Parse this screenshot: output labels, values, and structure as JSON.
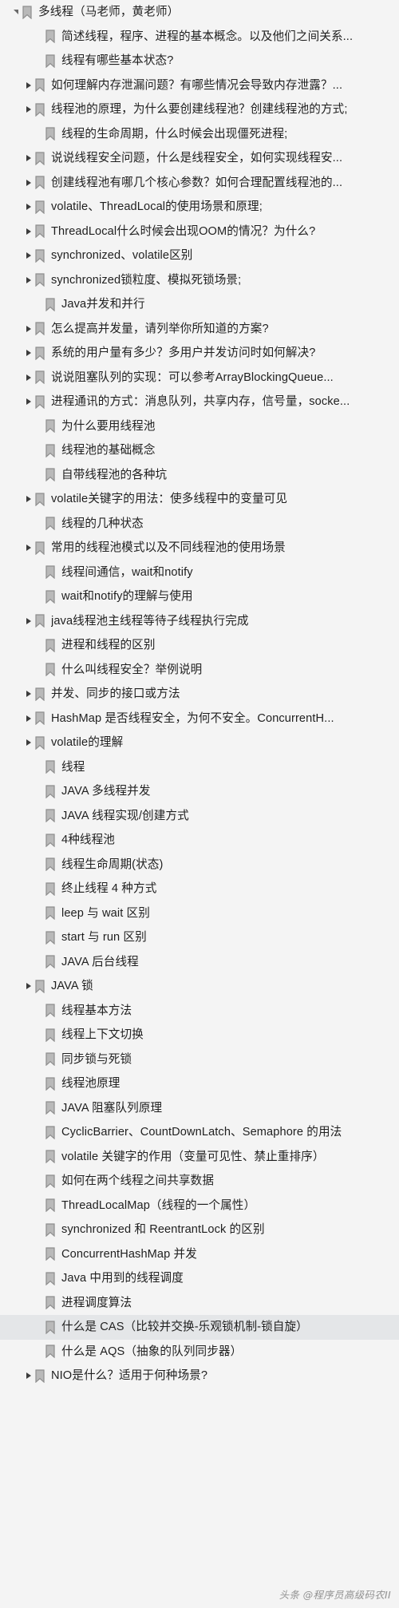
{
  "panel": {
    "background_color": "#f4f4f4",
    "selected_row_color": "#e4e6e8",
    "icon_name": "bookmark-icon",
    "expand_icon_name": "triangle-right-icon",
    "collapse_icon_name": "triangle-down-icon"
  },
  "watermark": {
    "text": "头条 @程序员高级码农II"
  },
  "tree": {
    "root": {
      "label": "多线程（马老师，黄老师）",
      "level": 0,
      "twisty": "expanded",
      "selected": false
    },
    "items": [
      {
        "label": "简述线程，程序、进程的基本概念。以及他们之间关系...",
        "level": 1,
        "twisty": "none",
        "selected": false
      },
      {
        "label": "线程有哪些基本状态?",
        "level": 1,
        "twisty": "none",
        "selected": false
      },
      {
        "label": "如何理解内存泄漏问题？有哪些情况会导致内存泄露？...",
        "level": 1,
        "twisty": "collapsed",
        "selected": false
      },
      {
        "label": "线程池的原理，为什么要创建线程池？创建线程池的方式;",
        "level": 1,
        "twisty": "collapsed",
        "selected": false
      },
      {
        "label": "线程的生命周期，什么时候会出现僵死进程;",
        "level": 1,
        "twisty": "none",
        "selected": false
      },
      {
        "label": "说说线程安全问题，什么是线程安全，如何实现线程安...",
        "level": 1,
        "twisty": "collapsed",
        "selected": false
      },
      {
        "label": "创建线程池有哪几个核心参数？如何合理配置线程池的...",
        "level": 1,
        "twisty": "collapsed",
        "selected": false
      },
      {
        "label": "volatile、ThreadLocal的使用场景和原理;",
        "level": 1,
        "twisty": "collapsed",
        "selected": false
      },
      {
        "label": "ThreadLocal什么时候会出现OOM的情况？为什么?",
        "level": 1,
        "twisty": "collapsed",
        "selected": false
      },
      {
        "label": "synchronized、volatile区别",
        "level": 1,
        "twisty": "collapsed",
        "selected": false
      },
      {
        "label": "synchronized锁粒度、模拟死锁场景;",
        "level": 1,
        "twisty": "collapsed",
        "selected": false
      },
      {
        "label": "Java并发和并行",
        "level": 1,
        "twisty": "none",
        "selected": false
      },
      {
        "label": "怎么提高并发量，请列举你所知道的方案?",
        "level": 1,
        "twisty": "collapsed",
        "selected": false
      },
      {
        "label": "系统的用户量有多少？多用户并发访问时如何解决?",
        "level": 1,
        "twisty": "collapsed",
        "selected": false
      },
      {
        "label": "说说阻塞队列的实现：可以参考ArrayBlockingQueue...",
        "level": 1,
        "twisty": "collapsed",
        "selected": false
      },
      {
        "label": "进程通讯的方式：消息队列，共享内存，信号量，socke...",
        "level": 1,
        "twisty": "collapsed",
        "selected": false
      },
      {
        "label": "为什么要用线程池",
        "level": 1,
        "twisty": "none",
        "selected": false
      },
      {
        "label": "线程池的基础概念",
        "level": 1,
        "twisty": "none",
        "selected": false
      },
      {
        "label": "自带线程池的各种坑",
        "level": 1,
        "twisty": "none",
        "selected": false
      },
      {
        "label": "volatile关键字的用法：使多线程中的变量可见",
        "level": 1,
        "twisty": "collapsed",
        "selected": false
      },
      {
        "label": "线程的几种状态",
        "level": 1,
        "twisty": "none",
        "selected": false
      },
      {
        "label": "常用的线程池模式以及不同线程池的使用场景",
        "level": 1,
        "twisty": "collapsed",
        "selected": false
      },
      {
        "label": "线程间通信，wait和notify",
        "level": 1,
        "twisty": "none",
        "selected": false
      },
      {
        "label": "wait和notify的理解与使用",
        "level": 1,
        "twisty": "none",
        "selected": false
      },
      {
        "label": "java线程池主线程等待子线程执行完成",
        "level": 1,
        "twisty": "collapsed",
        "selected": false
      },
      {
        "label": "进程和线程的区别",
        "level": 1,
        "twisty": "none",
        "selected": false
      },
      {
        "label": "什么叫线程安全？举例说明",
        "level": 1,
        "twisty": "none",
        "selected": false
      },
      {
        "label": "并发、同步的接口或方法",
        "level": 1,
        "twisty": "collapsed",
        "selected": false
      },
      {
        "label": "HashMap 是否线程安全，为何不安全。ConcurrentH...",
        "level": 1,
        "twisty": "collapsed",
        "selected": false
      },
      {
        "label": "volatile的理解",
        "level": 1,
        "twisty": "collapsed",
        "selected": false
      },
      {
        "label": "线程",
        "level": 1,
        "twisty": "none",
        "selected": false
      },
      {
        "label": "JAVA 多线程并发",
        "level": 1,
        "twisty": "none",
        "selected": false
      },
      {
        "label": "JAVA 线程实现/创建方式",
        "level": 1,
        "twisty": "none",
        "selected": false
      },
      {
        "label": "4种线程池",
        "level": 1,
        "twisty": "none",
        "selected": false
      },
      {
        "label": "线程生命周期(状态)",
        "level": 1,
        "twisty": "none",
        "selected": false
      },
      {
        "label": "终止线程 4 种方式",
        "level": 1,
        "twisty": "none",
        "selected": false
      },
      {
        "label": "leep 与 wait 区别",
        "level": 1,
        "twisty": "none",
        "selected": false
      },
      {
        "label": "start 与 run 区别",
        "level": 1,
        "twisty": "none",
        "selected": false
      },
      {
        "label": "JAVA 后台线程",
        "level": 1,
        "twisty": "none",
        "selected": false
      },
      {
        "label": "JAVA 锁",
        "level": 1,
        "twisty": "collapsed",
        "selected": false
      },
      {
        "label": "线程基本方法",
        "level": 1,
        "twisty": "none",
        "selected": false
      },
      {
        "label": "线程上下文切换",
        "level": 1,
        "twisty": "none",
        "selected": false
      },
      {
        "label": "同步锁与死锁",
        "level": 1,
        "twisty": "none",
        "selected": false
      },
      {
        "label": "线程池原理",
        "level": 1,
        "twisty": "none",
        "selected": false
      },
      {
        "label": "JAVA 阻塞队列原理",
        "level": 1,
        "twisty": "none",
        "selected": false
      },
      {
        "label": "CyclicBarrier、CountDownLatch、Semaphore 的用法",
        "level": 1,
        "twisty": "none",
        "selected": false
      },
      {
        "label": "volatile 关键字的作用（变量可见性、禁止重排序）",
        "level": 1,
        "twisty": "none",
        "selected": false
      },
      {
        "label": "如何在两个线程之间共享数据",
        "level": 1,
        "twisty": "none",
        "selected": false
      },
      {
        "label": "ThreadLocalMap（线程的一个属性）",
        "level": 1,
        "twisty": "none",
        "selected": false
      },
      {
        "label": "synchronized 和 ReentrantLock 的区别",
        "level": 1,
        "twisty": "none",
        "selected": false
      },
      {
        "label": "ConcurrentHashMap 并发",
        "level": 1,
        "twisty": "none",
        "selected": false
      },
      {
        "label": "Java 中用到的线程调度",
        "level": 1,
        "twisty": "none",
        "selected": false
      },
      {
        "label": "进程调度算法",
        "level": 1,
        "twisty": "none",
        "selected": false
      },
      {
        "label": "什么是 CAS（比较并交换-乐观锁机制-锁自旋）",
        "level": 1,
        "twisty": "none",
        "selected": true
      },
      {
        "label": "什么是 AQS（抽象的队列同步器）",
        "level": 1,
        "twisty": "none",
        "selected": false
      },
      {
        "label": "NIO是什么？适用于何种场景?",
        "level": 1,
        "twisty": "collapsed",
        "selected": false
      }
    ]
  }
}
